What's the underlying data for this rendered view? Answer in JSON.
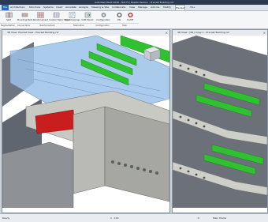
{
  "app": {
    "title": "Autodesk Revit 2016 - Not For Resale Version - Precast Building.rvt"
  },
  "tabs": [
    {
      "label": "File"
    },
    {
      "label": "Architecture"
    },
    {
      "label": "Structure"
    },
    {
      "label": "Systems"
    },
    {
      "label": "Insert"
    },
    {
      "label": "Annotate"
    },
    {
      "label": "Analyze"
    },
    {
      "label": "Massing & Site"
    },
    {
      "label": "Collaborate"
    },
    {
      "label": "View"
    },
    {
      "label": "Manage"
    },
    {
      "label": "Add-Ins"
    },
    {
      "label": "Modify"
    },
    {
      "label": "Precast"
    },
    {
      "label": "CS+"
    }
  ],
  "ribbon": {
    "buttons": [
      {
        "label": "Split",
        "icon": "split-icon"
      },
      {
        "label": "Mounting Parts",
        "icon": "mounting-parts-icon"
      },
      {
        "label": "Reinforcement",
        "icon": "reinforcement-icon"
      },
      {
        "label": "Custom Fabric Sheet",
        "icon": "fabric-sheet-icon"
      },
      {
        "label": "Shop Drawings",
        "icon": "shop-drawings-icon"
      },
      {
        "label": "CAM Export",
        "icon": "cam-export-icon"
      },
      {
        "label": "Configuration",
        "icon": "gear-icon"
      },
      {
        "label": "ON",
        "icon": "power-on-icon"
      },
      {
        "label": "On/Off",
        "icon": "power-off-icon"
      }
    ],
    "groups": [
      {
        "label": "Segmentation"
      },
      {
        "label": "Connections"
      },
      {
        "label": "Reinforcement"
      },
      {
        "label": "Fabrication"
      },
      {
        "label": "Configuration"
      },
      {
        "label": "Help"
      }
    ]
  },
  "viewports": {
    "left": {
      "title": "3D View: Precast View - Precast Building.rvt"
    },
    "right": {
      "title": "3D View: {3D} Copy 1 - Precast Building.rvt"
    }
  },
  "viewcontrol": {
    "scale": "1 : 100"
  },
  "status": {
    "ready": "Ready",
    "model": "Main Model",
    "zero": ":0"
  },
  "colors": {
    "stair": "#2fc12f",
    "beam": "#c81e1e",
    "concrete": "#c9c9c4",
    "glass": "#9cc2e8",
    "accent": "#2a6bb8"
  }
}
